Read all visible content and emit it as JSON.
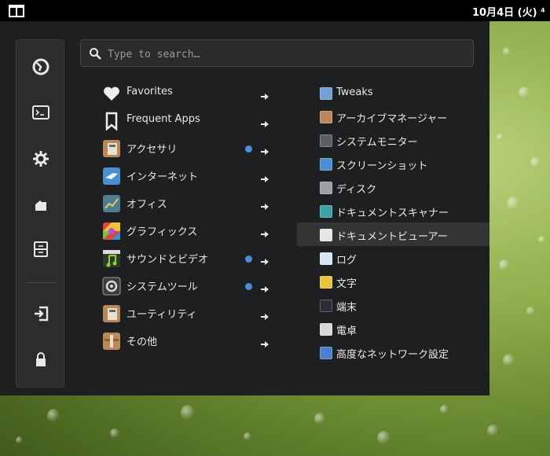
{
  "topbar": {
    "clock": "10月4日 (火) ⁴"
  },
  "search": {
    "placeholder": "Type to search…"
  },
  "sidebar": [
    {
      "name": "firefox-icon"
    },
    {
      "name": "terminal-icon"
    },
    {
      "name": "gear-icon"
    },
    {
      "name": "folder-icon"
    },
    {
      "name": "archive-icon"
    },
    {
      "name": "logout-icon"
    },
    {
      "name": "lock-icon"
    }
  ],
  "categories": [
    {
      "label": "Favorites",
      "icon": "heart-icon",
      "dot": false
    },
    {
      "label": "Frequent Apps",
      "icon": "bookmark-icon",
      "dot": false
    },
    {
      "label": "アクセサリ",
      "icon": "accessories-icon",
      "dot": true
    },
    {
      "label": "インターネット",
      "icon": "internet-icon",
      "dot": false
    },
    {
      "label": "オフィス",
      "icon": "office-icon",
      "dot": false
    },
    {
      "label": "グラフィックス",
      "icon": "graphics-icon",
      "dot": false
    },
    {
      "label": "サウンドとビデオ",
      "icon": "sound-video-icon",
      "dot": true
    },
    {
      "label": "システムツール",
      "icon": "system-tools-icon",
      "dot": true
    },
    {
      "label": "ユーティリティ",
      "icon": "utilities-icon",
      "dot": false
    },
    {
      "label": "その他",
      "icon": "other-icon",
      "dot": false
    }
  ],
  "apps": [
    {
      "label": "Tweaks",
      "icon": "tweaks-icon"
    },
    {
      "label": "アーカイブマネージャー",
      "icon": "archive-manager-icon"
    },
    {
      "label": "システムモニター",
      "icon": "system-monitor-icon"
    },
    {
      "label": "スクリーンショット",
      "icon": "screenshot-icon"
    },
    {
      "label": "ディスク",
      "icon": "disk-icon"
    },
    {
      "label": "ドキュメントスキャナー",
      "icon": "scanner-icon"
    },
    {
      "label": "ドキュメントビューアー",
      "icon": "document-viewer-icon"
    },
    {
      "label": "ログ",
      "icon": "logs-icon"
    },
    {
      "label": "文字",
      "icon": "characters-icon"
    },
    {
      "label": "端末",
      "icon": "terminal-app-icon"
    },
    {
      "label": "電卓",
      "icon": "calculator-icon"
    },
    {
      "label": "高度なネットワーク設定",
      "icon": "network-settings-icon"
    }
  ],
  "selected_app": "ドキュメントビューアー",
  "colors": {
    "menu_bg": "#1e1f21",
    "accent_dot": "#4a90d9",
    "topbar": "#000000"
  }
}
